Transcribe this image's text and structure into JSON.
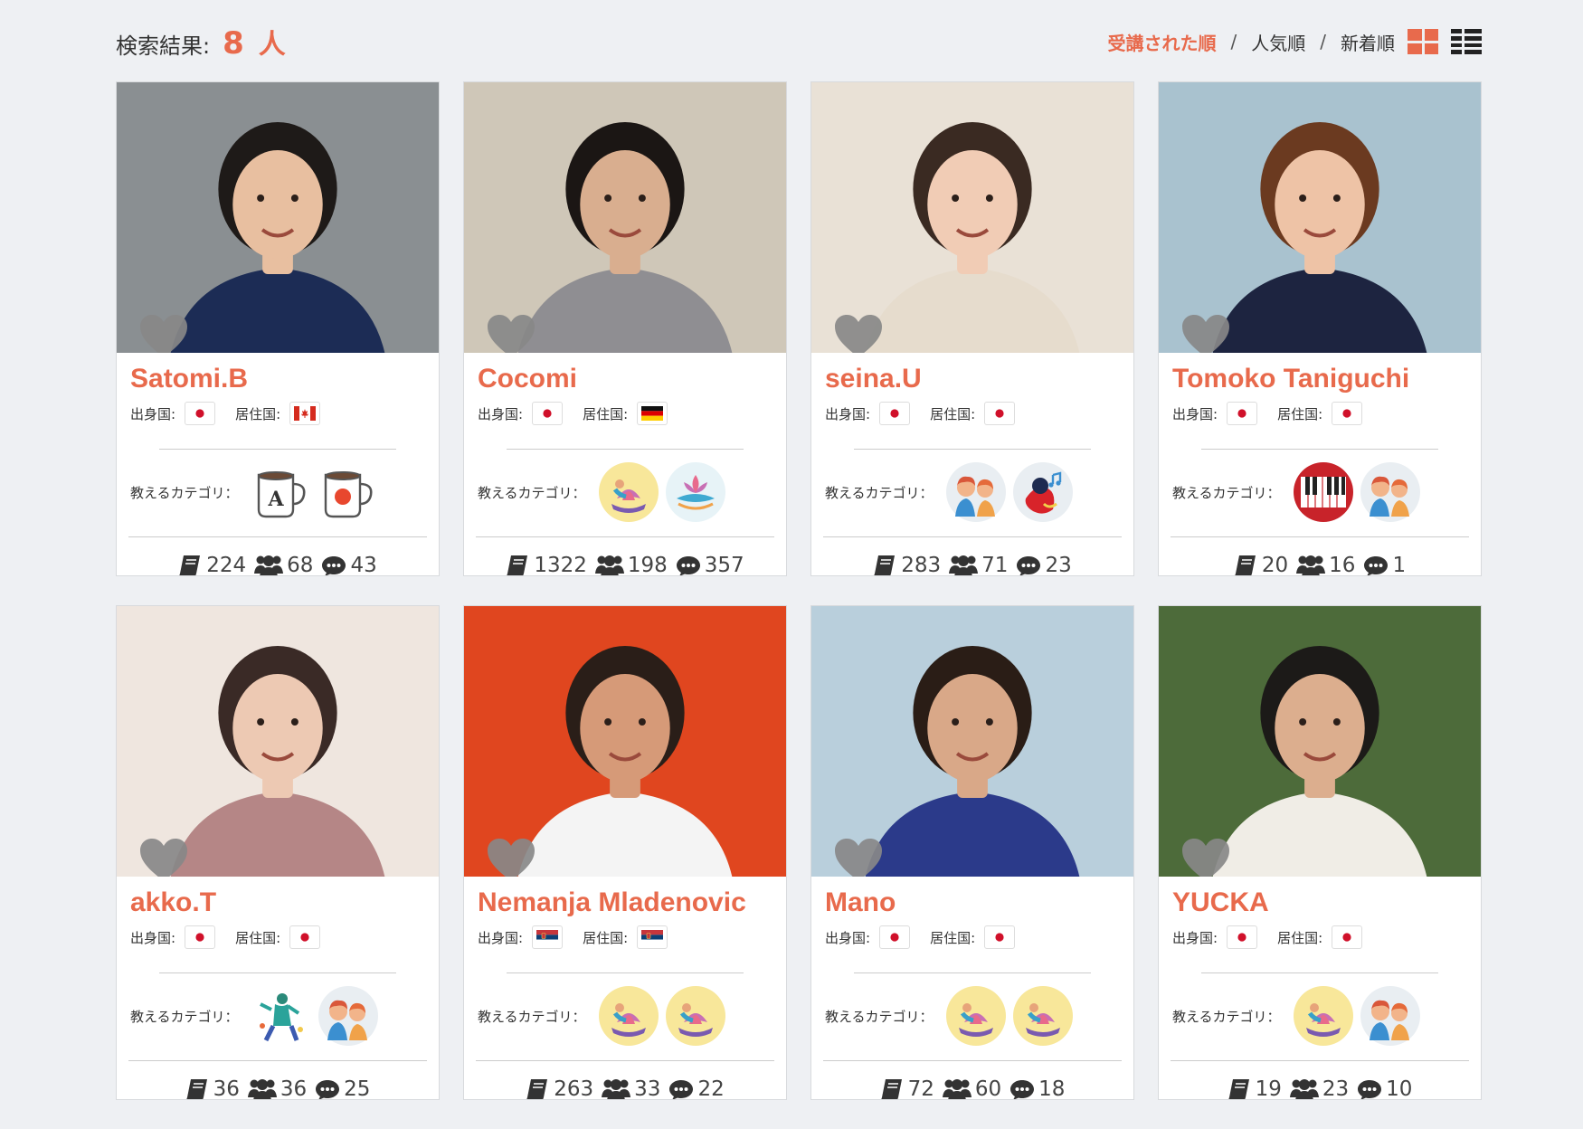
{
  "header": {
    "result_label": "検索結果:",
    "result_count": "8",
    "result_unit": "人",
    "sort_options": [
      {
        "label": "受講された順",
        "active": true
      },
      {
        "label": "人気順",
        "active": false
      },
      {
        "label": "新着順",
        "active": false
      }
    ],
    "separator": "/",
    "view_modes": [
      "grid-view-icon",
      "list-view-icon"
    ]
  },
  "labels": {
    "origin": "出身国:",
    "residence": "居住国:",
    "category": "教えるカテゴリ："
  },
  "colors": {
    "accent": "#e86a4c",
    "heart": "#888888"
  },
  "teachers": [
    {
      "name": "Satomi.B",
      "origin_flag": "japan-flag",
      "residence_flag": "canada-flag",
      "categories": [
        "english-cup-icon",
        "japanese-cup-icon"
      ],
      "lessons": "224",
      "students": "68",
      "reviews": "43",
      "photo_bg": "#8a8f92",
      "photo_skin": "#e8bfa0",
      "photo_hair": "#1e1a18",
      "photo_cloth": "#1c2c55"
    },
    {
      "name": "Cocomi",
      "origin_flag": "japan-flag",
      "residence_flag": "germany-flag",
      "categories": [
        "yoga-icon",
        "yoga-lotus-icon"
      ],
      "lessons": "1322",
      "students": "198",
      "reviews": "357",
      "photo_bg": "#cfc7b8",
      "photo_skin": "#d9ae8f",
      "photo_hair": "#1b1614",
      "photo_cloth": "#8f8e92"
    },
    {
      "name": "seina.U",
      "origin_flag": "japan-flag",
      "residence_flag": "japan-flag",
      "categories": [
        "kids-icon",
        "singing-icon"
      ],
      "lessons": "283",
      "students": "71",
      "reviews": "23",
      "photo_bg": "#e9e1d6",
      "photo_skin": "#f1ccb5",
      "photo_hair": "#3a2a22",
      "photo_cloth": "#e6dccd"
    },
    {
      "name": "Tomoko Taniguchi",
      "origin_flag": "japan-flag",
      "residence_flag": "japan-flag",
      "categories": [
        "piano-icon",
        "kids-icon"
      ],
      "lessons": "20",
      "students": "16",
      "reviews": "1",
      "photo_bg": "#a9c2cf",
      "photo_skin": "#eec3a6",
      "photo_hair": "#6b3a20",
      "photo_cloth": "#1d2440"
    },
    {
      "name": "akko.T",
      "origin_flag": "japan-flag",
      "residence_flag": "japan-flag",
      "categories": [
        "dance-icon",
        "kids-icon"
      ],
      "lessons": "36",
      "students": "36",
      "reviews": "25",
      "photo_bg": "#efe6df",
      "photo_skin": "#edc9b3",
      "photo_hair": "#3a2a26",
      "photo_cloth": "#b58686"
    },
    {
      "name": "Nemanja Mladenovic",
      "origin_flag": "serbia-flag",
      "residence_flag": "serbia-flag",
      "categories": [
        "yoga-icon",
        "yoga-icon"
      ],
      "lessons": "263",
      "students": "33",
      "reviews": "22",
      "photo_bg": "#e0461f",
      "photo_skin": "#d69a78",
      "photo_hair": "#2a1e18",
      "photo_cloth": "#f4f4f4"
    },
    {
      "name": "Mano",
      "origin_flag": "japan-flag",
      "residence_flag": "japan-flag",
      "categories": [
        "yoga-icon",
        "yoga-icon"
      ],
      "lessons": "72",
      "students": "60",
      "reviews": "18",
      "photo_bg": "#b9cfdc",
      "photo_skin": "#d9a888",
      "photo_hair": "#2a1d16",
      "photo_cloth": "#2b3a8a"
    },
    {
      "name": "YUCKA",
      "origin_flag": "japan-flag",
      "residence_flag": "japan-flag",
      "categories": [
        "yoga-icon",
        "kids-icon"
      ],
      "lessons": "19",
      "students": "23",
      "reviews": "10",
      "photo_bg": "#4d6b3a",
      "photo_skin": "#dcae8e",
      "photo_hair": "#1c1a18",
      "photo_cloth": "#f0ede6"
    }
  ]
}
